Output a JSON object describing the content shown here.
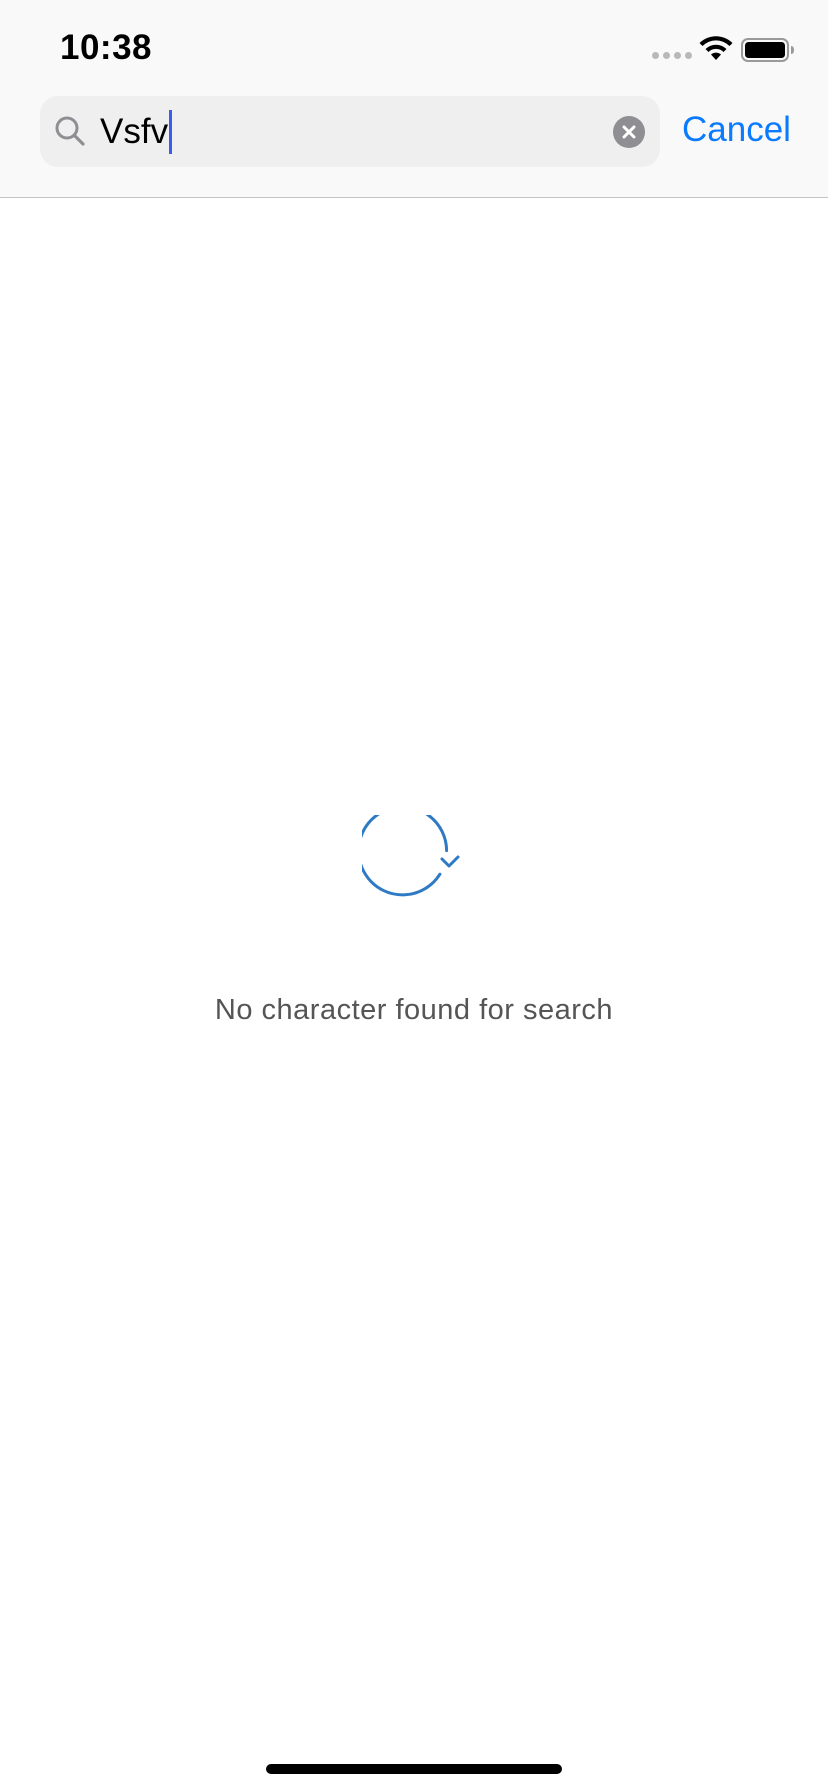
{
  "status_bar": {
    "time": "10:38"
  },
  "search": {
    "query": "Vsfv",
    "cancel_label": "Cancel"
  },
  "empty_state": {
    "message": "No character found for search",
    "icon": "refresh-icon"
  },
  "colors": {
    "accent": "#0a7aff",
    "cursor": "#3c5cf0",
    "icon_blue": "#2f7ac4",
    "muted_text": "#555555"
  }
}
